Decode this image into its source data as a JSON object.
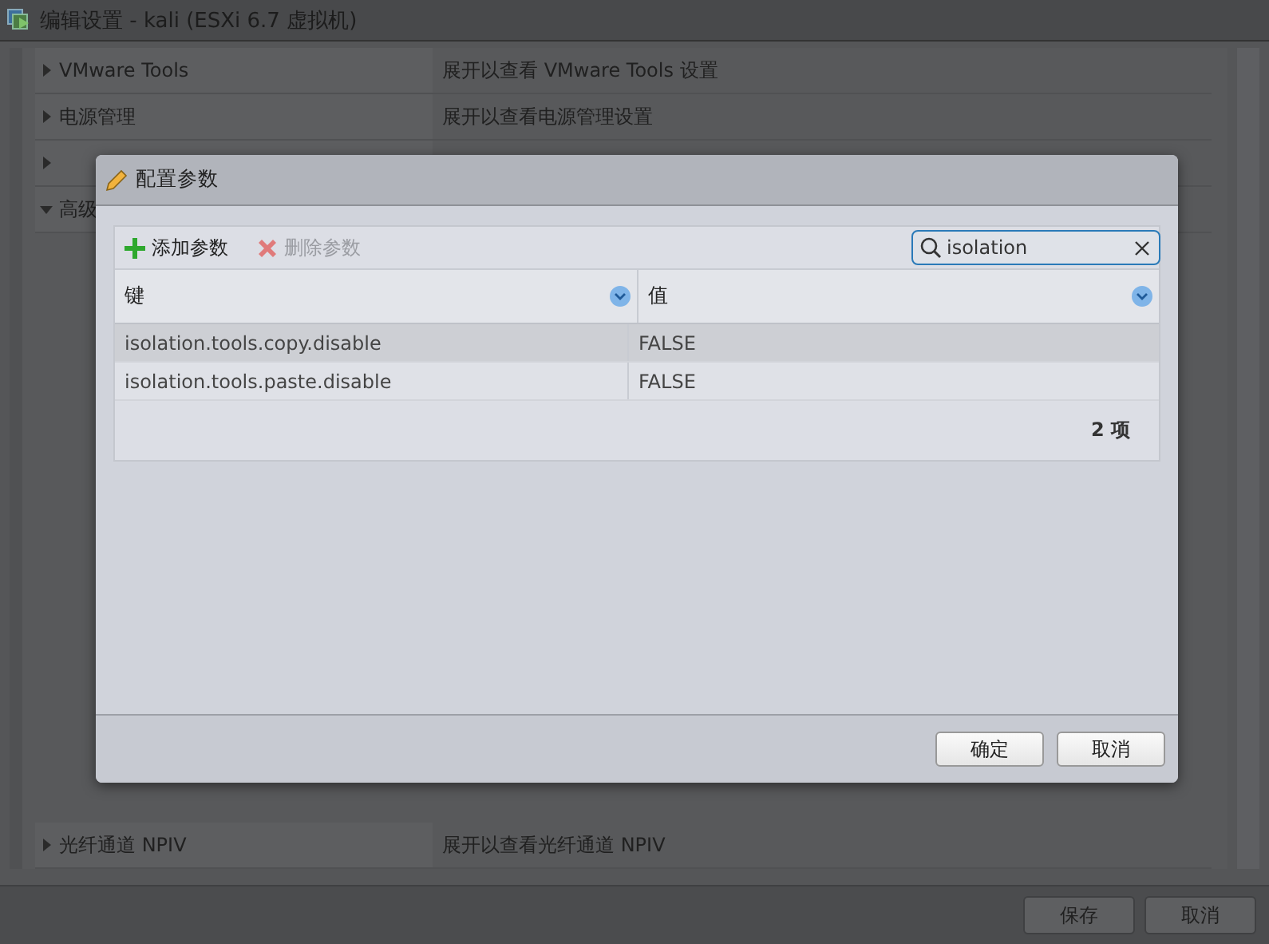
{
  "window": {
    "title": "编辑设置 - kali (ESXi 6.7 虚拟机)"
  },
  "settings": {
    "rows_top": [
      {
        "label": "VMware Tools",
        "description": "展开以查看 VMware Tools 设置",
        "expanded": false
      },
      {
        "label": "电源管理",
        "description": "展开以查看电源管理设置",
        "expanded": false
      },
      {
        "expanded": false
      },
      {
        "label": "高级",
        "expanded": true
      }
    ],
    "rows_bottom": [
      {
        "label": "光纤通道 NPIV",
        "description": "展开以查看光纤通道 NPIV",
        "expanded": false
      }
    ]
  },
  "footer_buttons": [
    "保存",
    "取消"
  ],
  "dialog": {
    "title": "配置参数",
    "toolbar": [
      {
        "kind": "add",
        "label": "添加参数",
        "disabled": false
      },
      {
        "kind": "remove",
        "label": "删除参数",
        "disabled": true
      }
    ],
    "search": {
      "value": "isolation"
    },
    "columns": [
      "键",
      "值"
    ],
    "rows": [
      {
        "key": "isolation.tools.copy.disable",
        "value": "FALSE",
        "selected": true
      },
      {
        "key": "isolation.tools.paste.disable",
        "value": "FALSE",
        "selected": false
      }
    ],
    "count": "2 项",
    "buttons": [
      "确定",
      "取消"
    ]
  }
}
